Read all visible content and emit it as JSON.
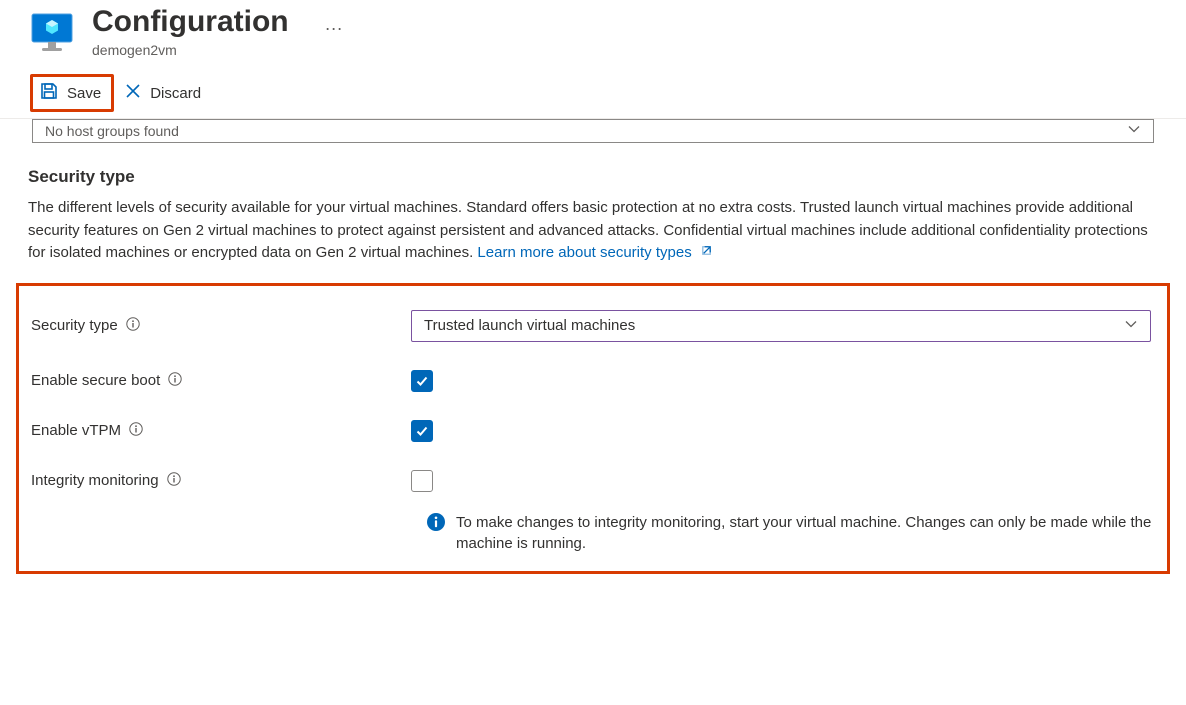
{
  "header": {
    "title": "Configuration",
    "subtitle": "demogen2vm"
  },
  "toolbar": {
    "save_label": "Save",
    "discard_label": "Discard"
  },
  "host_group": {
    "placeholder": "No host groups found"
  },
  "security": {
    "heading": "Security type",
    "description": "The different levels of security available for your virtual machines. Standard offers basic protection at no extra costs. Trusted launch virtual machines provide additional security features on Gen 2 virtual machines to protect against persistent and advanced attacks. Confidential virtual machines include additional confidentiality protections for isolated machines or encrypted data on Gen 2 virtual machines.",
    "learn_more": "Learn more about security types",
    "fields": {
      "security_type": {
        "label": "Security type",
        "value": "Trusted launch virtual machines"
      },
      "secure_boot": {
        "label": "Enable secure boot",
        "checked": true
      },
      "vtpm": {
        "label": "Enable vTPM",
        "checked": true
      },
      "integrity": {
        "label": "Integrity monitoring",
        "checked": false
      }
    },
    "note": "To make changes to integrity monitoring, start your virtual machine. Changes can only be made while the machine is running."
  }
}
